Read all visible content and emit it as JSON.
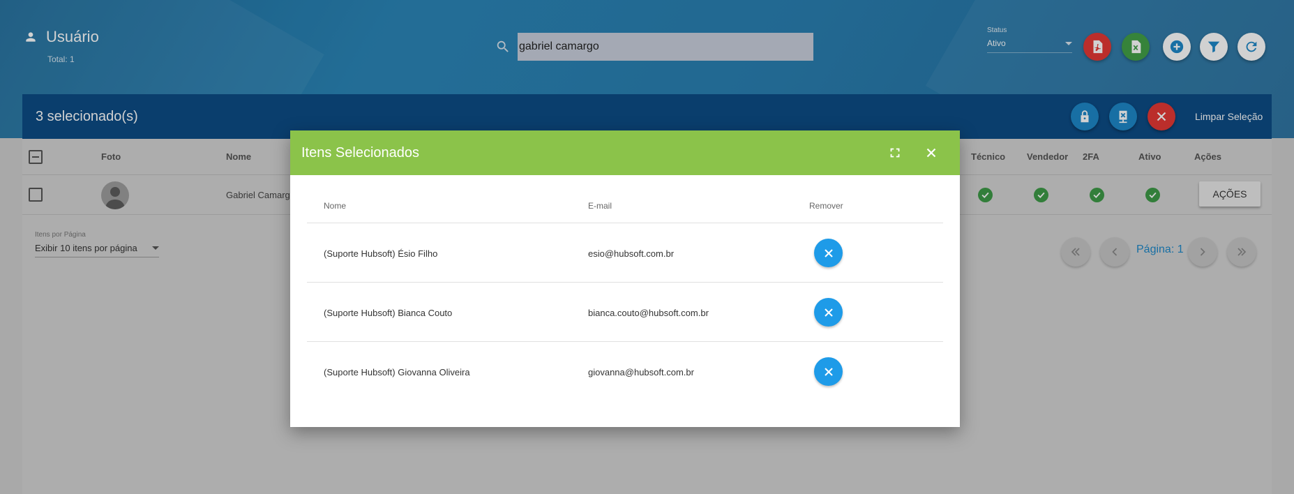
{
  "header": {
    "title": "Usuário",
    "total": "Total: 1",
    "search_value": "gabriel camargo",
    "status_label": "Status",
    "status_value": "Ativo",
    "buttons": [
      "pdf-icon",
      "excel-icon",
      "add-icon",
      "filter-icon",
      "refresh-icon"
    ],
    "button_colors": [
      "#e53935",
      "#43a047",
      "#ffffff",
      "#ffffff",
      "#ffffff"
    ]
  },
  "selection_bar": {
    "text": "3 selecionado(s)",
    "clear_label": "Limpar Seleção",
    "buttons": [
      "lock-icon",
      "remove-device-icon",
      "close-icon"
    ]
  },
  "table": {
    "columns": [
      "Foto",
      "Nome",
      "Técnico",
      "Vendedor",
      "2FA",
      "Ativo",
      "Ações"
    ],
    "rows": [
      {
        "nome": "Gabriel Camargo",
        "tecnico": true,
        "vendedor": true,
        "twofa": true,
        "ativo": true,
        "acoes": "AÇÕES"
      }
    ]
  },
  "pagination": {
    "items_per_page_label": "Itens por Página",
    "items_per_page_value": "Exibir 10 itens por página",
    "page_label": "Página: 1"
  },
  "dialog": {
    "title": "Itens Selecionados",
    "columns": [
      "Nome",
      "E-mail",
      "Remover"
    ],
    "rows": [
      {
        "nome": "(Suporte Hubsoft) Ésio Filho",
        "email": "esio@hubsoft.com.br"
      },
      {
        "nome": "(Suporte Hubsoft) Bianca Couto",
        "email": "bianca.couto@hubsoft.com.br"
      },
      {
        "nome": "(Suporte Hubsoft) Giovanna Oliveira",
        "email": "giovanna@hubsoft.com.br"
      }
    ]
  },
  "colors": {
    "header_bg": "#2a7fb1",
    "selection_bar": "#0d4c86",
    "dialog_header": "#8bc34a",
    "remove_button": "#1e9be8",
    "check": "#3d9a47",
    "page_label": "#1e88c8"
  }
}
